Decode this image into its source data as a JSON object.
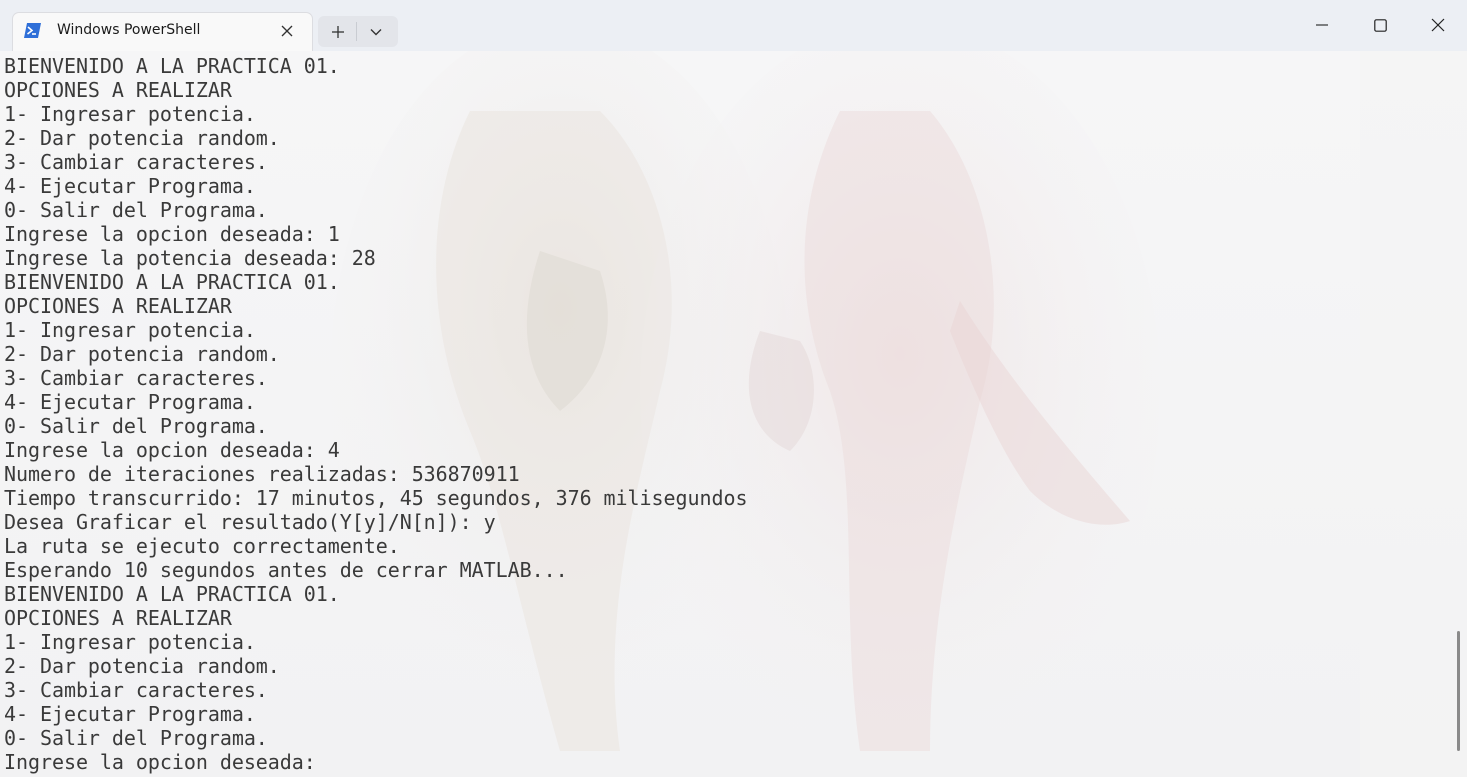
{
  "window": {
    "tab_title": "Windows PowerShell",
    "tab_icon": "powershell-icon",
    "new_tab_icon": "plus-icon",
    "dropdown_icon": "chevron-down-icon",
    "minimize_icon": "minimize-icon",
    "maximize_icon": "maximize-icon",
    "close_icon": "close-icon",
    "accent_color": "#2f6fd8"
  },
  "terminal": {
    "lines": [
      "BIENVENIDO A LA PRACTICA 01.",
      "OPCIONES A REALIZAR",
      "1- Ingresar potencia.",
      "2- Dar potencia random.",
      "3- Cambiar caracteres.",
      "4- Ejecutar Programa.",
      "0- Salir del Programa.",
      "Ingrese la opcion deseada: 1",
      "Ingrese la potencia deseada: 28",
      "BIENVENIDO A LA PRACTICA 01.",
      "OPCIONES A REALIZAR",
      "1- Ingresar potencia.",
      "2- Dar potencia random.",
      "3- Cambiar caracteres.",
      "4- Ejecutar Programa.",
      "0- Salir del Programa.",
      "Ingrese la opcion deseada: 4",
      "Numero de iteraciones realizadas: 536870911",
      "Tiempo transcurrido: 17 minutos, 45 segundos, 376 milisegundos",
      "Desea Graficar el resultado(Y[y]/N[n]): y",
      "La ruta se ejecuto correctamente.",
      "Esperando 10 segundos antes de cerrar MATLAB...",
      "BIENVENIDO A LA PRACTICA 01.",
      "OPCIONES A REALIZAR",
      "1- Ingresar potencia.",
      "2- Dar potencia random.",
      "3- Cambiar caracteres.",
      "4- Ejecutar Programa.",
      "0- Salir del Programa.",
      "Ingrese la opcion deseada: "
    ],
    "text_color": "#3a3a3a",
    "background_image": "anime-characters-wallpaper"
  }
}
